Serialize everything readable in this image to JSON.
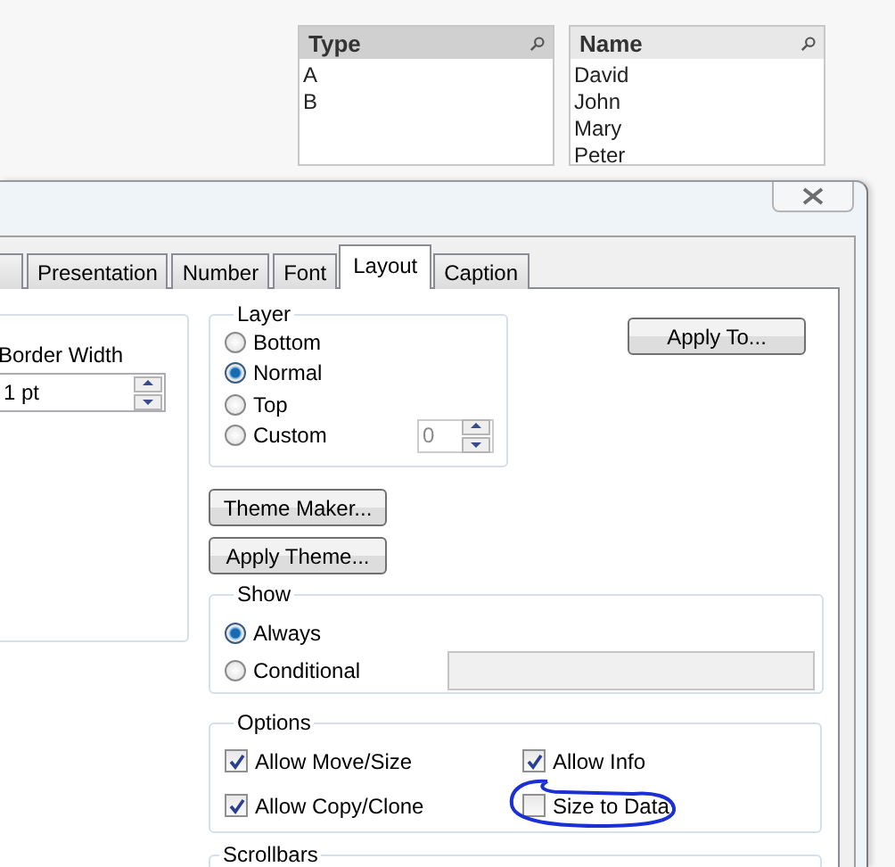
{
  "list_boxes": [
    {
      "title": "Type",
      "active": true,
      "values": [
        "A",
        "B"
      ]
    },
    {
      "title": "Name",
      "active": false,
      "values": [
        "David",
        "John",
        "Mary",
        "Peter"
      ]
    }
  ],
  "dialog": {
    "tabs": [
      {
        "label": "Presentation",
        "selected": false
      },
      {
        "label": "Number",
        "selected": false
      },
      {
        "label": "Font",
        "selected": false
      },
      {
        "label": "Layout",
        "selected": true
      },
      {
        "label": "Caption",
        "selected": false
      }
    ],
    "border_width": {
      "label": "Border Width",
      "value": "1 pt"
    },
    "layer": {
      "title": "Layer",
      "options": [
        {
          "label": "Bottom",
          "selected": false
        },
        {
          "label": "Normal",
          "selected": true
        },
        {
          "label": "Top",
          "selected": false
        },
        {
          "label": "Custom",
          "selected": false
        }
      ],
      "custom_value": "0",
      "custom_disabled": true
    },
    "apply_to_button": "Apply To...",
    "theme_buttons": [
      "Theme Maker...",
      "Apply Theme..."
    ],
    "show": {
      "title": "Show",
      "options": [
        {
          "label": "Always",
          "selected": true
        },
        {
          "label": "Conditional",
          "selected": false
        }
      ],
      "condition_disabled": true
    },
    "options": {
      "title": "Options",
      "items": [
        {
          "label": "Allow Move/Size",
          "checked": true,
          "highlighted": false
        },
        {
          "label": "Allow Info",
          "checked": true,
          "highlighted": false
        },
        {
          "label": "Allow Copy/Clone",
          "checked": true,
          "highlighted": false
        },
        {
          "label": "Size to Data",
          "checked": false,
          "highlighted": true
        }
      ]
    },
    "scrollbars": {
      "title": "Scrollbars"
    }
  }
}
